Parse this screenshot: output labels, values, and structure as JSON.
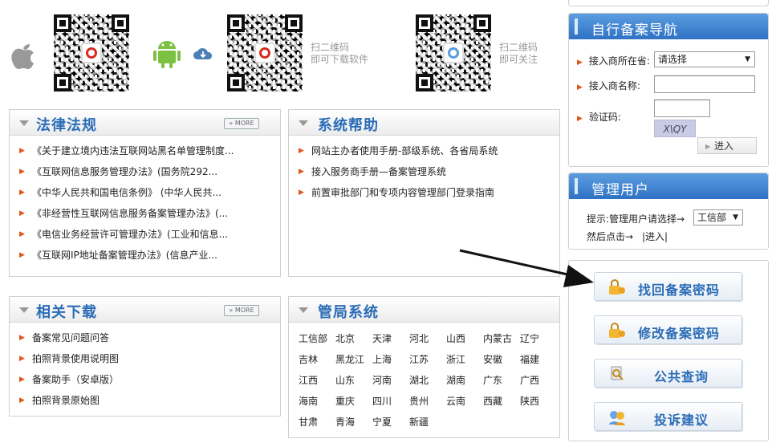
{
  "top": {
    "scan_download_line1": "扫二维码",
    "scan_download_line2": "即可下载软件",
    "scan_follow_line1": "扫二维码",
    "scan_follow_line2": "即可关注"
  },
  "laws": {
    "title": "法律法规",
    "more": "» MORE",
    "items": [
      "《关于建立境内违法互联网站黑名单管理制度...",
      "《互联网信息服务管理办法》(国务院292...",
      "《中华人民共和国电信条例》 (中华人民共...",
      "《非经营性互联网信息服务备案管理办法》(...",
      "《电信业务经营许可管理办法》(工业和信息...",
      "《互联网IP地址备案管理办法》(信息产业..."
    ]
  },
  "help": {
    "title": "系统帮助",
    "items": [
      "网站主办者使用手册-部级系统、各省局系统",
      "接入服务商手册—备案管理系统",
      "前置审批部门和专项内容管理部门登录指南"
    ]
  },
  "downloads": {
    "title": "相关下载",
    "more": "» MORE",
    "items": [
      "备案常见问题问答",
      "拍照背景使用说明图",
      "备案助手（安卓版）",
      "拍照背景原始图"
    ]
  },
  "bureau": {
    "title": "管局系统",
    "rows": [
      [
        "工信部",
        "北京",
        "天津",
        "河北",
        "山西",
        "内蒙古",
        "辽宁"
      ],
      [
        "吉林",
        "黑龙江",
        "上海",
        "江苏",
        "浙江",
        "安徽",
        "福建"
      ],
      [
        "江西",
        "山东",
        "河南",
        "湖北",
        "湖南",
        "广东",
        "广西"
      ],
      [
        "海南",
        "重庆",
        "四川",
        "贵州",
        "云南",
        "西藏",
        "陕西"
      ],
      [
        "甘肃",
        "青海",
        "宁夏",
        "新疆"
      ]
    ]
  },
  "self_nav": {
    "title": "自行备案导航",
    "province_label": "接入商所在省:",
    "province_value": "请选择",
    "name_label": "接入商名称:",
    "captcha_label": "验证码:",
    "captcha_text": "X\\QY",
    "enter": "进入"
  },
  "admin": {
    "title": "管理用户",
    "hint": "提示:管理用户请选择→",
    "select_value": "工信部",
    "then_click": "然后点击→",
    "enter_link": "|进入|"
  },
  "actions": {
    "find_password": "找回备案密码",
    "change_password": "修改备案密码",
    "public_query": "公共查询",
    "complaint": "投诉建议"
  },
  "colors": {
    "accent": "#2a6cb6",
    "arrow": "#e0571a",
    "header_blue": "#3a7dcc"
  }
}
